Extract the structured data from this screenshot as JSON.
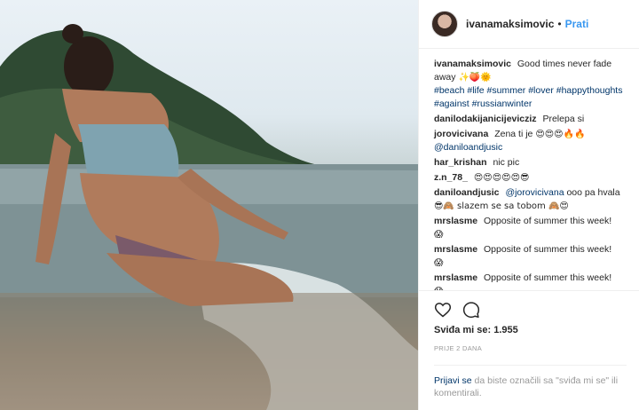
{
  "header": {
    "username": "ivanamaksimovic",
    "dot": "•",
    "follow_label": "Prati"
  },
  "caption": {
    "user": "ivanamaksimovic",
    "text": "Good times never fade away",
    "emojis": "✨🍑🌞",
    "hashtags": "#beach #life #summer #lover #happythoughts #against #russianwinter"
  },
  "comments": [
    {
      "user": "danilodakijanicijevicziz",
      "text": "Prelepa si",
      "mention": "",
      "emojis": ""
    },
    {
      "user": "jorovicivana",
      "text": "Zena ti je",
      "emojis": "😍😍😍🔥🔥",
      "mention": "@daniloandjusic"
    },
    {
      "user": "har_krishan",
      "text": "nic pic",
      "mention": "",
      "emojis": ""
    },
    {
      "user": "z.n_78_",
      "text": "",
      "emojis": "😍😍😍😍😍😎",
      "mention": ""
    },
    {
      "user": "daniloandjusic",
      "mention": "@jorovicivana",
      "text": "ooo pa hvala",
      "emojis2": "😎🙈 slazem se sa tobom 🙈😍",
      "emojis": ""
    },
    {
      "user": "mrslasme",
      "text": "Opposite of summer this week!",
      "emojis": "😱",
      "mention": ""
    },
    {
      "user": "mrslasme",
      "text": "Opposite of summer this week!",
      "emojis": "😱",
      "mention": ""
    },
    {
      "user": "mrslasme",
      "text": "Opposite of summer this week!",
      "emojis": "😱",
      "mention": ""
    }
  ],
  "actions": {
    "like_icon": "heart-icon",
    "comment_icon": "comment-icon"
  },
  "likes_label": "Sviđa mi se: 1.955",
  "time_label": "PRIJE 2 DANA",
  "login": {
    "link": "Prijavi se",
    "text": " da biste označili sa \"sviđa mi se\" ili komentirali."
  }
}
